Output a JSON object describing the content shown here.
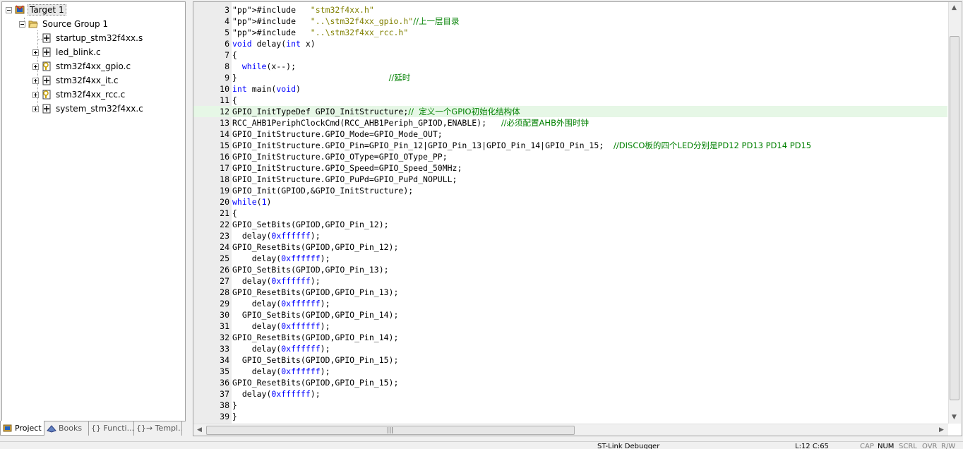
{
  "project_tree": {
    "target": "Target 1",
    "group": "Source Group 1",
    "files": [
      {
        "name": "startup_stm32f4xx.s",
        "expander": "none",
        "icon": "asm-file-icon"
      },
      {
        "name": "led_blink.c",
        "expander": "plus",
        "icon": "c-file-icon"
      },
      {
        "name": "stm32f4xx_gpio.c",
        "expander": "plus",
        "icon": "locked-c-file-icon"
      },
      {
        "name": "stm32f4xx_it.c",
        "expander": "plus",
        "icon": "c-file-icon"
      },
      {
        "name": "stm32f4xx_rcc.c",
        "expander": "plus",
        "icon": "locked-c-file-icon"
      },
      {
        "name": "system_stm32f4xx.c",
        "expander": "plus",
        "icon": "c-file-icon"
      }
    ]
  },
  "panel_tabs": [
    {
      "label": "Project",
      "icon": "project-icon"
    },
    {
      "label": "Books",
      "icon": "books-icon"
    },
    {
      "label": "{} Functi...",
      "icon": "functions-icon"
    },
    {
      "label": "{}→ Templ...",
      "icon": "templates-icon"
    }
  ],
  "editor": {
    "highlight_line": 12,
    "lines": [
      {
        "n": "3",
        "code": "#include   \"stm32f4xx.h\""
      },
      {
        "n": "4",
        "code": "#include   \"..\\stm32f4xx_gpio.h\"//上一层目录"
      },
      {
        "n": "5",
        "code": "#include   \"..\\stm32f4xx_rcc.h\""
      },
      {
        "n": "6",
        "code": "void delay(int x)"
      },
      {
        "n": "7",
        "code": "{"
      },
      {
        "n": "8",
        "code": "  while(x--);"
      },
      {
        "n": "9",
        "code": "}                               //延时"
      },
      {
        "n": "10",
        "code": "int main(void)"
      },
      {
        "n": "11",
        "code": "{"
      },
      {
        "n": "12",
        "code": "GPIO_InitTypeDef GPIO_InitStructure;//  定义一个GPIO初始化结构体"
      },
      {
        "n": "13",
        "code": "RCC_AHB1PeriphClockCmd(RCC_AHB1Periph_GPIOD,ENABLE);   //必须配置AHB外围时钟"
      },
      {
        "n": "14",
        "code": "GPIO_InitStructure.GPIO_Mode=GPIO_Mode_OUT;"
      },
      {
        "n": "15",
        "code": "GPIO_InitStructure.GPIO_Pin=GPIO_Pin_12|GPIO_Pin_13|GPIO_Pin_14|GPIO_Pin_15;  //DISCO板的四个LED分别是PD12 PD13 PD14 PD15"
      },
      {
        "n": "16",
        "code": "GPIO_InitStructure.GPIO_OType=GPIO_OType_PP;"
      },
      {
        "n": "17",
        "code": "GPIO_InitStructure.GPIO_Speed=GPIO_Speed_50MHz;"
      },
      {
        "n": "18",
        "code": "GPIO_InitStructure.GPIO_PuPd=GPIO_PuPd_NOPULL;"
      },
      {
        "n": "19",
        "code": "GPIO_Init(GPIOD,&GPIO_InitStructure);"
      },
      {
        "n": "20",
        "code": "while(1)"
      },
      {
        "n": "21",
        "code": "{"
      },
      {
        "n": "22",
        "code": "GPIO_SetBits(GPIOD,GPIO_Pin_12);"
      },
      {
        "n": "23",
        "code": "  delay(0xffffff);"
      },
      {
        "n": "24",
        "code": "GPIO_ResetBits(GPIOD,GPIO_Pin_12);"
      },
      {
        "n": "25",
        "code": "    delay(0xffffff);"
      },
      {
        "n": "26",
        "code": "GPIO_SetBits(GPIOD,GPIO_Pin_13);"
      },
      {
        "n": "27",
        "code": "  delay(0xffffff);"
      },
      {
        "n": "28",
        "code": "GPIO_ResetBits(GPIOD,GPIO_Pin_13);"
      },
      {
        "n": "29",
        "code": "    delay(0xffffff);"
      },
      {
        "n": "30",
        "code": "  GPIO_SetBits(GPIOD,GPIO_Pin_14);"
      },
      {
        "n": "31",
        "code": "    delay(0xffffff);"
      },
      {
        "n": "32",
        "code": "GPIO_ResetBits(GPIOD,GPIO_Pin_14);"
      },
      {
        "n": "33",
        "code": "    delay(0xffffff);"
      },
      {
        "n": "34",
        "code": "  GPIO_SetBits(GPIOD,GPIO_Pin_15);"
      },
      {
        "n": "35",
        "code": "    delay(0xffffff);"
      },
      {
        "n": "36",
        "code": "GPIO_ResetBits(GPIOD,GPIO_Pin_15);"
      },
      {
        "n": "37",
        "code": "  delay(0xffffff);"
      },
      {
        "n": "38",
        "code": "}"
      },
      {
        "n": "39",
        "code": "}"
      }
    ]
  },
  "status_bar": {
    "debugger": "ST-Link Debugger",
    "position": "L:12 C:65",
    "cap": "CAP",
    "num": "NUM",
    "scrl": "SCRL",
    "ovr": "OVR",
    "rw": "R/W"
  },
  "colors": {
    "keyword": "#0000ff",
    "preprocessor": "#808000",
    "comment": "#008000",
    "highlight": "#e6f7e6"
  }
}
